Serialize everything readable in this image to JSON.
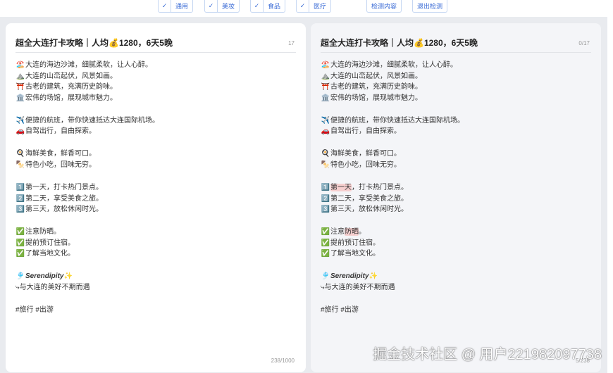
{
  "toolbar": {
    "checkboxes": [
      {
        "label": "通用",
        "checked": true
      },
      {
        "label": "美妆",
        "checked": true
      },
      {
        "label": "食品",
        "checked": true
      },
      {
        "label": "医疗",
        "checked": true
      }
    ],
    "detect_button": "检测内容",
    "exit_button": "退出检测"
  },
  "left": {
    "title": "超全大连打卡攻略｜人均💰1280，6天5晚",
    "title_count": "17",
    "lines": [
      [
        "🏖️",
        "大连的海边沙滩，细腻柔软，让人心醉。"
      ],
      [
        "⛰️",
        "大连的山峦起伏，风景如画。"
      ],
      [
        "⛩️",
        "古老的建筑，充满历史韵味。"
      ],
      [
        "🏛️",
        "宏伟的场馆，展现城市魅力。"
      ],
      [
        "✈️",
        "便捷的航班，带你快速抵达大连国际机场。"
      ],
      [
        "🚗",
        "自驾出行，自由探索。"
      ],
      [
        "🍳",
        "海鲜美食，鲜香可口。"
      ],
      [
        "🍢",
        "特色小吃，回味无穷。"
      ],
      [
        "1️⃣",
        "第一天，打卡热门景点。"
      ],
      [
        "2️⃣",
        "第二天，享受美食之旅。"
      ],
      [
        "3️⃣",
        "第三天，放松休闲时光。"
      ],
      [
        "✅",
        "注意防晒。"
      ],
      [
        "✅",
        "提前预订住宿。"
      ],
      [
        "✅",
        "了解当地文化。"
      ],
      [
        "🎐",
        "Serendipity",
        "✨"
      ],
      [
        "⤷",
        "与大连的美好不期而遇"
      ],
      [
        "",
        "#旅行 #出游"
      ]
    ],
    "char_count": "238/1000"
  },
  "right": {
    "title": "超全大连打卡攻略｜人均💰1280，6天5晚",
    "title_count": "0/17",
    "lines": [
      [
        "🏖️",
        "大连的海边沙滩，细腻柔软，让人心醉。"
      ],
      [
        "⛰️",
        "大连的山峦起伏，风景如画。"
      ],
      [
        "⛩️",
        "古老的建筑，充满历史韵味。"
      ],
      [
        "🏛️",
        "宏伟的场馆，展现城市魅力。"
      ],
      [
        "✈️",
        "便捷的航班，带你快速抵达大连国际机场。"
      ],
      [
        "🚗",
        "自驾出行，自由探索。"
      ],
      [
        "🍳",
        "海鲜美食，鲜香可口。"
      ],
      [
        "🍢",
        "特色小吃，回味无穷。"
      ],
      [
        "1️⃣",
        "第一天",
        "，打卡热门景点。"
      ],
      [
        "2️⃣",
        "第二天，享受美食之旅。"
      ],
      [
        "3️⃣",
        "第三天，放松休闲时光。"
      ],
      [
        "✅",
        "注意",
        "防晒",
        "。"
      ],
      [
        "✅",
        "提前预订住宿。"
      ],
      [
        "✅",
        "了解当地文化。"
      ],
      [
        "🎐",
        "Serendipity",
        "✨"
      ],
      [
        "⤷",
        "与大连的美好不期而遇"
      ],
      [
        "",
        "#旅行 #出游"
      ]
    ],
    "char_count": "5/238"
  },
  "watermark": "掘金技术社区 @ 用户221982097738"
}
